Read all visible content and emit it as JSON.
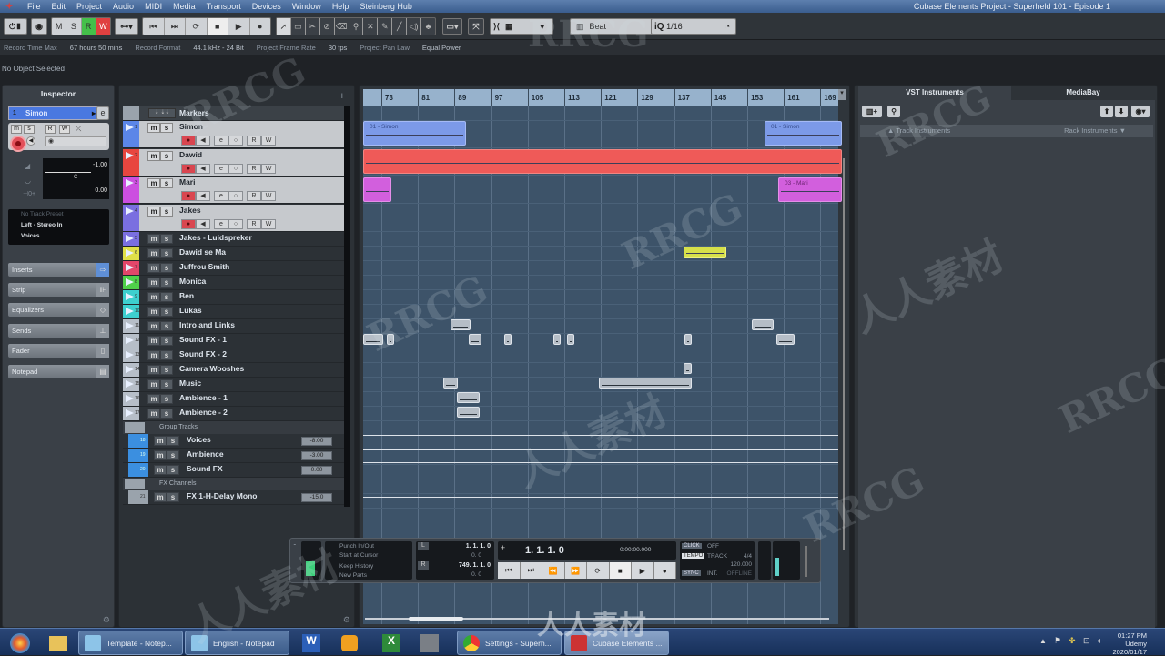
{
  "menu": {
    "items": [
      "File",
      "Edit",
      "Project",
      "Audio",
      "MIDI",
      "Media",
      "Transport",
      "Devices",
      "Window",
      "Help",
      "Steinberg Hub"
    ],
    "window_title": "Cubase Elements Project - Superheld 101 - Episode 1"
  },
  "toolbar": {
    "mode_buttons": [
      "M",
      "S",
      "R",
      "W"
    ],
    "snap_type": "Beat",
    "quantize": "1/16",
    "colors": {
      "r_button": "#44c04a",
      "w_button": "#e04040"
    }
  },
  "infoline": {
    "record_time_max_label": "Record Time Max",
    "record_time_max_value": "67 hours 50 mins",
    "record_format_label": "Record Format",
    "record_format_value": "44.1 kHz - 24 Bit",
    "frame_rate_label": "Project Frame Rate",
    "frame_rate_value": "30 fps",
    "pan_law_label": "Project Pan Law",
    "pan_law_value": "Equal Power"
  },
  "status": {
    "no_object": "No Object Selected"
  },
  "inspector": {
    "title": "Inspector",
    "track_number": "1",
    "track_name": "Simon",
    "volume": "-1.00",
    "pan_label": "C",
    "pan_value": "0.00",
    "preset": "No Track Preset",
    "input": "Left - Stereo In",
    "output": "Voices",
    "sections": [
      "Inserts",
      "Strip",
      "Equalizers",
      "Sends",
      "Fader",
      "Notepad"
    ]
  },
  "tracklist": {
    "markers_label": "Markers",
    "audio_tracks": [
      {
        "num": "1",
        "name": "Simon",
        "color": "#5b86e8"
      },
      {
        "num": "2",
        "name": "Dawid",
        "color": "#e8463f"
      },
      {
        "num": "3",
        "name": "Mari",
        "color": "#cc4fe0"
      },
      {
        "num": "4",
        "name": "Jakes",
        "color": "#7a6fe0"
      }
    ],
    "tracks": [
      {
        "num": "5",
        "name": "Jakes - Luidspreker",
        "color": "#7a6fe0"
      },
      {
        "num": "6",
        "name": "Dawid se Ma",
        "color": "#e0e048"
      },
      {
        "num": "7",
        "name": "Juffrou Smith",
        "color": "#e2466a"
      },
      {
        "num": "8",
        "name": "Monica",
        "color": "#4fd04a"
      },
      {
        "num": "9",
        "name": "Ben",
        "color": "#3dcfcf"
      },
      {
        "num": "10",
        "name": "Lukas",
        "color": "#3dcfcf"
      },
      {
        "num": "11",
        "name": "Intro and Links",
        "color": "#b6bec8"
      },
      {
        "num": "12",
        "name": "Sound FX - 1",
        "color": "#b6bec8"
      },
      {
        "num": "13",
        "name": "Sound FX - 2",
        "color": "#b6bec8"
      },
      {
        "num": "14",
        "name": "Camera Wooshes",
        "color": "#b6bec8"
      },
      {
        "num": "15",
        "name": "Music",
        "color": "#b6bec8"
      },
      {
        "num": "16",
        "name": "Ambience - 1",
        "color": "#b6bec8"
      },
      {
        "num": "17",
        "name": "Ambience - 2",
        "color": "#b6bec8"
      }
    ],
    "group_folder": "Group Tracks",
    "groups": [
      {
        "num": "18",
        "name": "Voices",
        "volume": "-8.00"
      },
      {
        "num": "19",
        "name": "Ambience",
        "volume": "-3.00"
      },
      {
        "num": "20",
        "name": "Sound FX",
        "volume": "0.00"
      }
    ],
    "fx_folder": "FX Channels",
    "fx": [
      {
        "num": "21",
        "name": "FX 1-H-Delay Mono",
        "volume": "-15.0"
      }
    ],
    "button_labels": {
      "mute": "m",
      "solo": "s",
      "read": "R",
      "write": "W"
    }
  },
  "arrange": {
    "ruler": [
      "73",
      "81",
      "89",
      "97",
      "105",
      "113",
      "121",
      "129",
      "137",
      "145",
      "153",
      "161",
      "169"
    ],
    "events": {
      "simon_1": "01 - Simon",
      "simon_2": "01 - Simon",
      "mari": "03 - Mari"
    }
  },
  "rightpanel": {
    "tabs": [
      "VST Instruments",
      "MediaBay"
    ],
    "track_instruments": "Track Instruments",
    "rack_instruments": "Rack Instruments"
  },
  "transport": {
    "punch": "Punch In/Out",
    "start_at_cursor": "Start at Cursor",
    "keep_history": "Keep History",
    "new_parts": "New Parts",
    "left_locator": "1. 1. 1.    0",
    "left_sub": "0.    0",
    "right_locator": "749. 1. 1.    0",
    "right_sub": "0.    0",
    "position": "1.  1.  1.    0",
    "time": "0:00:00.000",
    "click_label": "CLICK",
    "click_value": "OFF",
    "tempo_label": "TEMPO",
    "tempo_mode": "TRACK",
    "signature": "4/4",
    "tempo": "120.000",
    "sync_label": "SYNC",
    "sync_mode": "INT.",
    "sync_state": "OFFLINE"
  },
  "taskbar": {
    "tasks": [
      "Template - Notep...",
      "English - Notepad",
      "Settings - Superh...",
      "Cubase Elements ..."
    ],
    "time": "01:27 PM",
    "date": "2020/01/17",
    "user": "Udemy"
  },
  "watermarks": [
    "RRCG",
    "人人素材"
  ]
}
